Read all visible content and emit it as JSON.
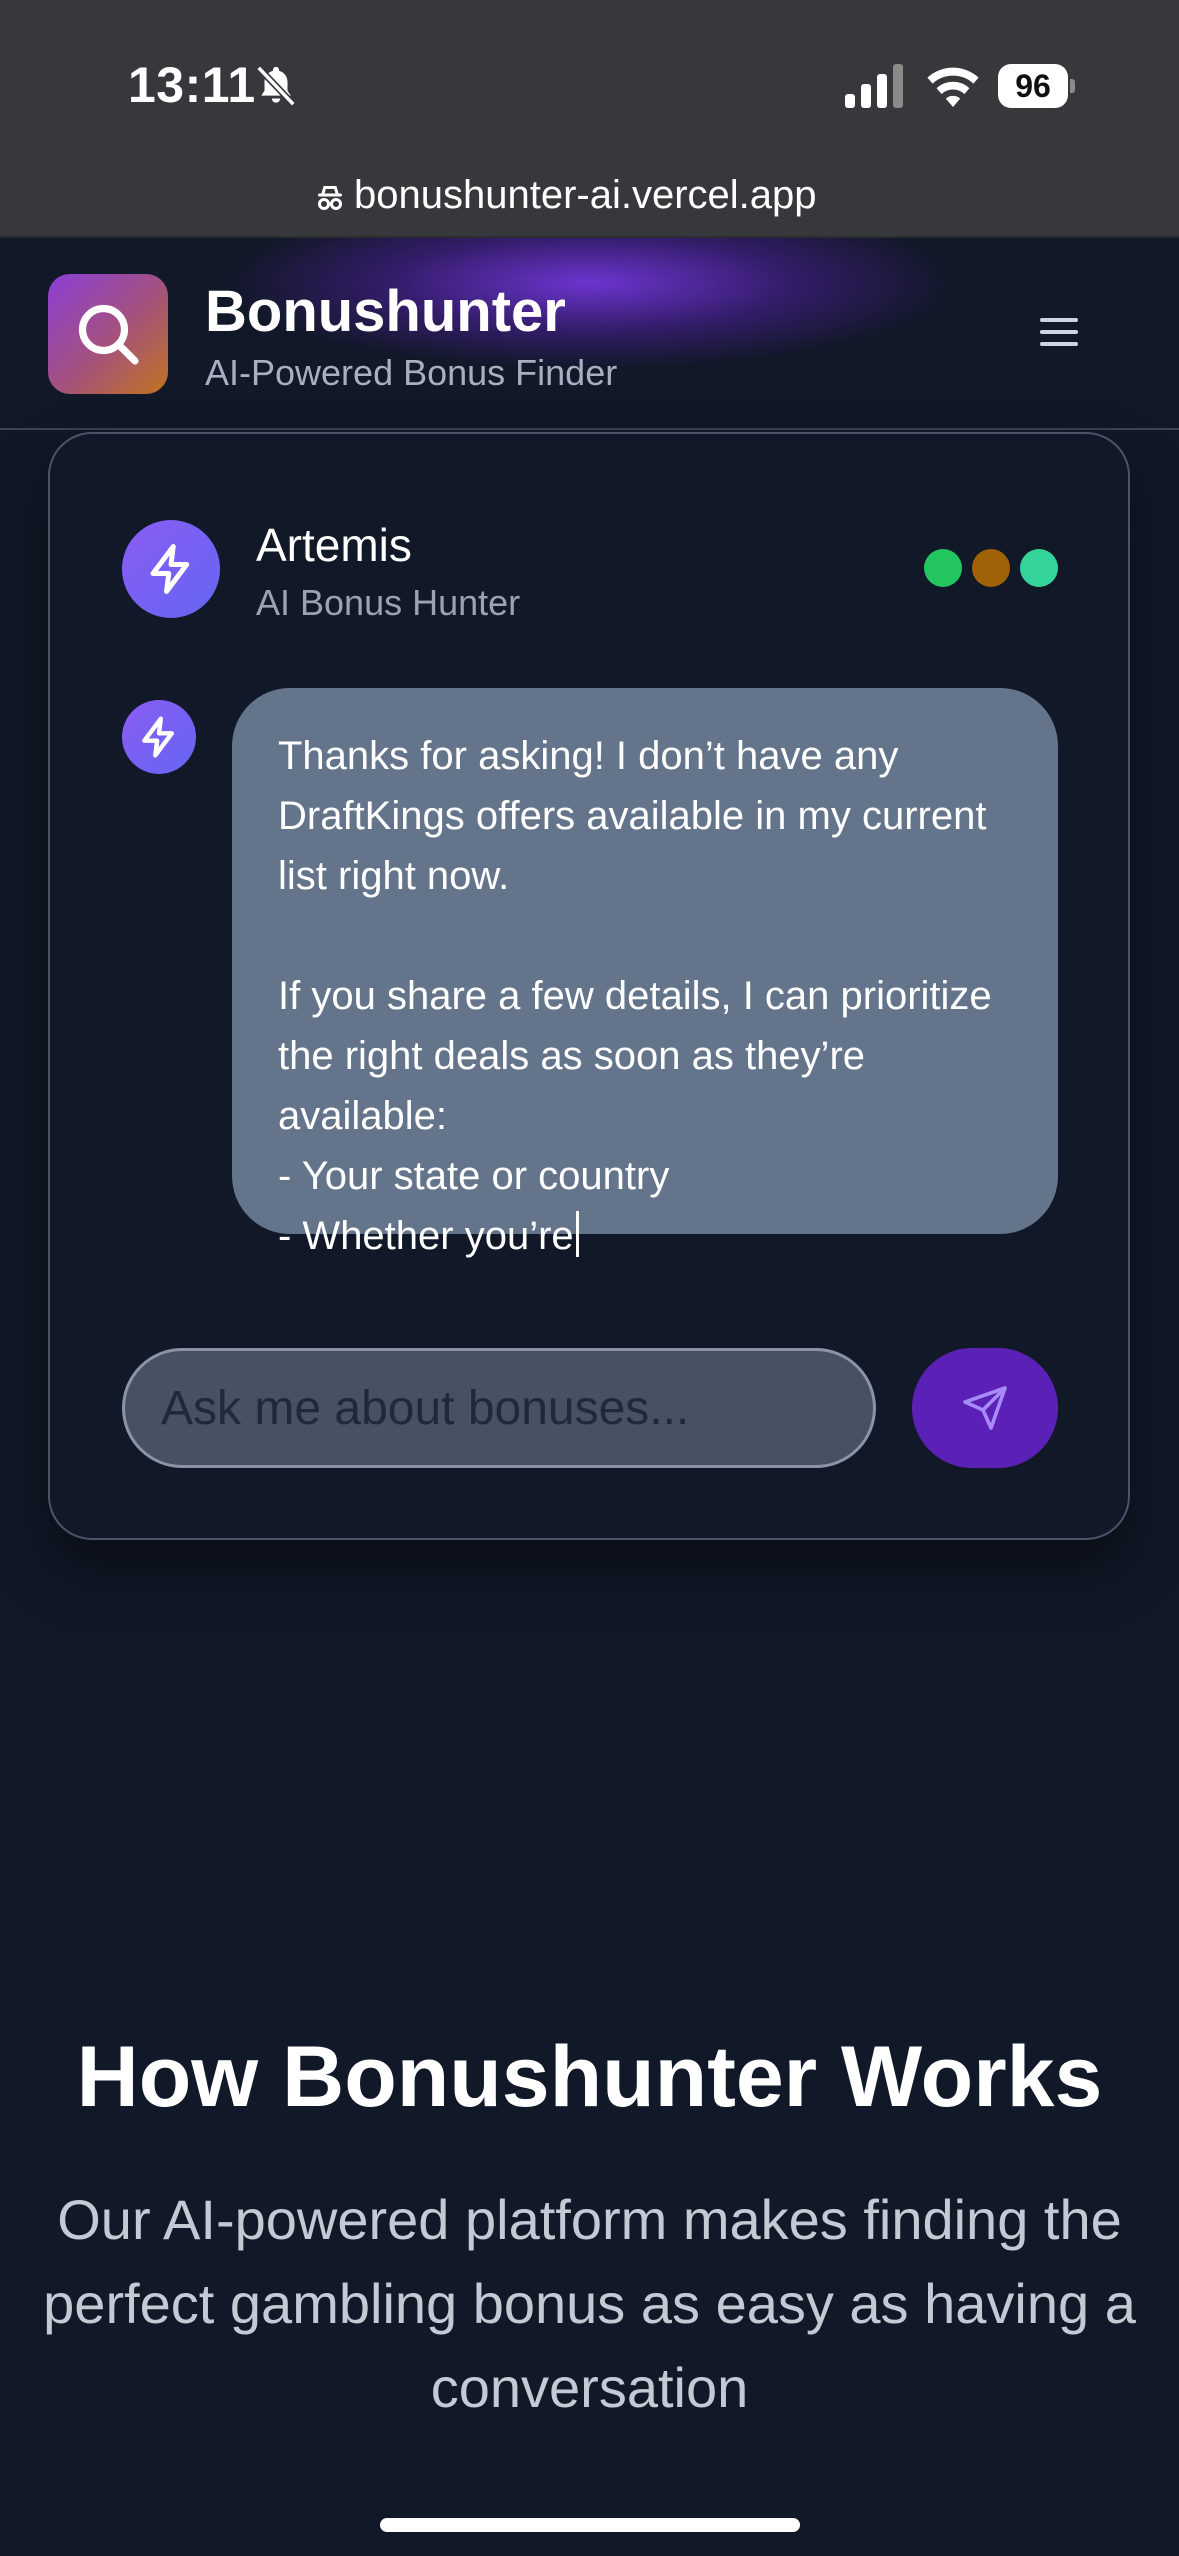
{
  "status_bar": {
    "time": "13:11",
    "battery": "96",
    "icons": [
      "bell-slash-icon",
      "signal-icon",
      "wifi-icon",
      "battery-icon"
    ]
  },
  "browser": {
    "url": "bonushunter-ai.vercel.app"
  },
  "header": {
    "brand": "Bonushunter",
    "tagline": "AI-Powered Bonus Finder",
    "logo_icon": "search-icon",
    "menu_icon": "hamburger-menu-icon"
  },
  "chat": {
    "agent_name": "Artemis",
    "agent_role": "AI Bonus Hunter",
    "status_dot_colors": [
      "#22c55e",
      "#a16207",
      "#34d399"
    ],
    "message": "Thanks for asking! I don’t have any DraftKings offers available in my current list right now.\n\nIf you share a few details, I can prioritize the right deals as soon as they’re available:\n- Your state or country\n- Whether you’re",
    "input_placeholder": "Ask me about bonuses...",
    "send_icon": "send-icon"
  },
  "how_it_works": {
    "title": "How Bonushunter Works",
    "subtitle": "Our AI-powered platform makes finding the perfect gambling bonus as easy as having a conversation"
  },
  "colors": {
    "background": "#111827",
    "accent": "#5b21b6",
    "bubble": "#64748b"
  }
}
